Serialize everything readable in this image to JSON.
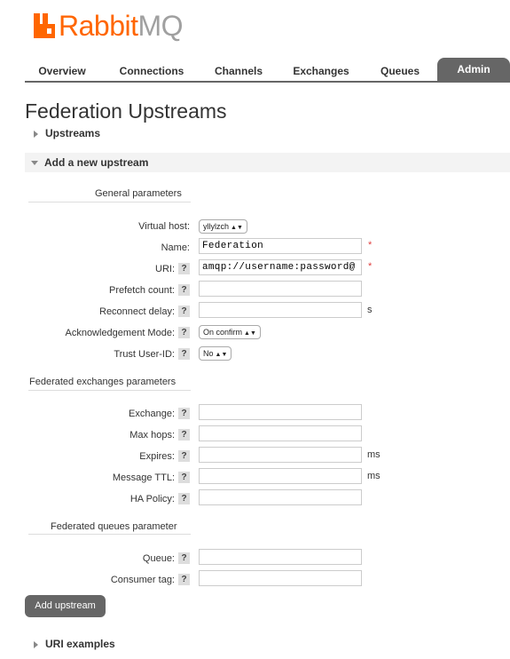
{
  "logo": {
    "part1": "Rabbit",
    "part2": "MQ"
  },
  "tabs": [
    "Overview",
    "Connections",
    "Channels",
    "Exchanges",
    "Queues",
    "Admin"
  ],
  "active_tab": "Admin",
  "page_title": "Federation Upstreams",
  "sections": {
    "upstreams": "Upstreams",
    "add_new": "Add a new upstream",
    "uri_examples": "URI examples"
  },
  "groups": {
    "general": "General parameters",
    "exchanges": "Federated exchanges parameters",
    "queues": "Federated queues parameter"
  },
  "help_glyph": "?",
  "required_mark": "*",
  "form": {
    "virtual_host": {
      "label": "Virtual host:",
      "value": "yllylzch"
    },
    "name": {
      "label": "Name:",
      "value": "Federation"
    },
    "uri": {
      "label": "URI:",
      "value": "amqp://username:password@"
    },
    "prefetch": {
      "label": "Prefetch count:",
      "value": ""
    },
    "reconnect": {
      "label": "Reconnect delay:",
      "value": "",
      "unit": "s"
    },
    "ack_mode": {
      "label": "Acknowledgement Mode:",
      "value": "On confirm"
    },
    "trust_user": {
      "label": "Trust User-ID:",
      "value": "No"
    },
    "exchange": {
      "label": "Exchange:",
      "value": ""
    },
    "max_hops": {
      "label": "Max hops:",
      "value": ""
    },
    "expires": {
      "label": "Expires:",
      "value": "",
      "unit": "ms"
    },
    "message_ttl": {
      "label": "Message TTL:",
      "value": "",
      "unit": "ms"
    },
    "ha_policy": {
      "label": "HA Policy:",
      "value": ""
    },
    "queue": {
      "label": "Queue:",
      "value": ""
    },
    "consumer_tag": {
      "label": "Consumer tag:",
      "value": ""
    }
  },
  "add_button": "Add upstream",
  "colors": {
    "brand": "#ff6600",
    "tab_active": "#666666",
    "required": "#e04040"
  }
}
